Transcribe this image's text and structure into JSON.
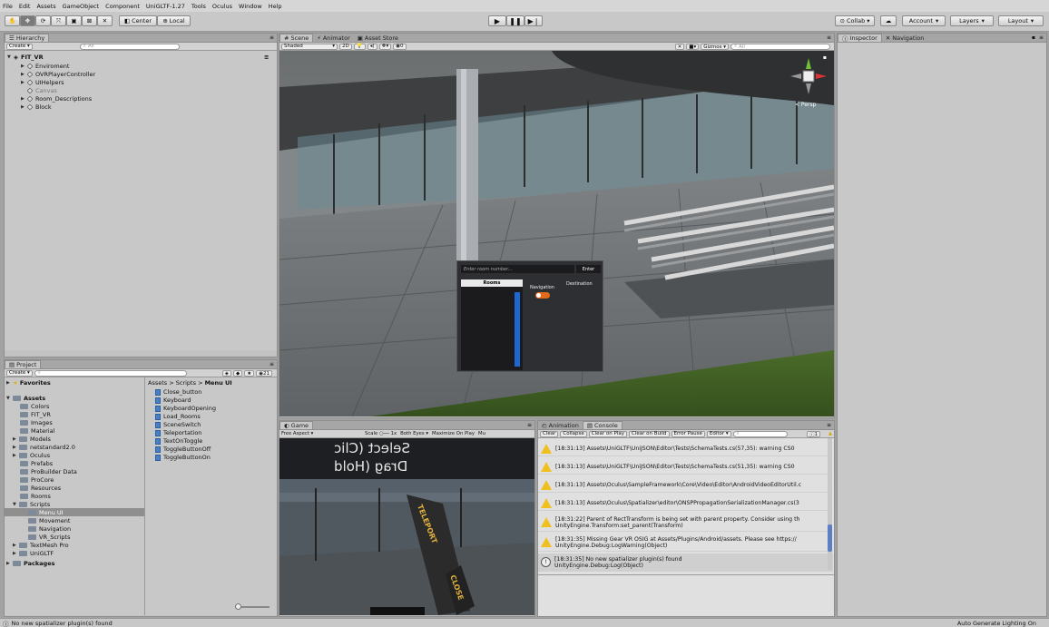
{
  "menu": [
    "File",
    "Edit",
    "Assets",
    "GameObject",
    "Component",
    "UniGLTF-1.27",
    "Tools",
    "Oculus",
    "Window",
    "Help"
  ],
  "toolbar": {
    "center_label": "Center",
    "local_label": "Local",
    "collab_label": "Collab",
    "account_label": "Account",
    "layers_label": "Layers",
    "layout_label": "Layout"
  },
  "hierarchy": {
    "tab": "Hierarchy",
    "create": "Create",
    "search_placeholder": "All",
    "scene_name": "FIT_VR",
    "items": [
      "Enviroment",
      "OVRPlayerController",
      "UIHelpers",
      "Canvas",
      "Room_Descriptions",
      "Block"
    ]
  },
  "scene": {
    "tabs": [
      "Scene",
      "Animator",
      "Asset Store"
    ],
    "shaded": "Shaded",
    "mode_2d": "2D",
    "fx_count": "0",
    "gizmos": "Gizmos",
    "search_placeholder": "All",
    "persp": "< Persp",
    "ui": {
      "input_placeholder": "Enter room number...",
      "enter": "Enter",
      "rooms": "Rooms",
      "navigation": "Navigation",
      "destination": "Destination"
    }
  },
  "inspector": {
    "tabs": [
      "Inspector",
      "Navigation"
    ]
  },
  "project": {
    "tab": "Project",
    "create": "Create",
    "count": "21",
    "favorites": "Favorites",
    "assets": "Assets",
    "folders": [
      "Colors",
      "FIT_VR",
      "Images",
      "Material",
      "Models",
      "netstandard2.0",
      "Oculus",
      "Prefabs",
      "ProBuilder Data",
      "ProCore",
      "Resources",
      "Rooms",
      "Scripts",
      "Menu UI",
      "Movement",
      "Navigation",
      "VR_Scripts",
      "TextMesh Pro",
      "UniGLTF"
    ],
    "packages": "Packages",
    "breadcrumb": [
      "Assets",
      "Scripts",
      "Menu UI"
    ],
    "files": [
      "Close_button",
      "Keyboard",
      "KeyboardOpening",
      "Load_Rooms",
      "SceneSwitch",
      "Teleportation",
      "TextOnToggle",
      "ToggleButtonOff",
      "ToggleButtonOn"
    ]
  },
  "game": {
    "tab": "Game",
    "aspect": "Free Aspect",
    "scale_label": "Scale",
    "scale_value": "1x",
    "both_eyes": "Both Eyes",
    "maximize": "Maximize On Play",
    "mute": "Mu",
    "overlay_text1": "Select (Clic",
    "overlay_text2": "Drag (Hold",
    "sign1": "TELEPORT",
    "sign2": "CLOSE"
  },
  "console": {
    "tabs": [
      "Animation",
      "Console"
    ],
    "buttons": [
      "Clear",
      "Collapse",
      "Clear on Play",
      "Clear on Build",
      "Error Pause",
      "Editor"
    ],
    "info_count": "1",
    "entries": [
      {
        "type": "warning",
        "line1": "[18:31:13] Assets\\UniGLTF\\UniJSON\\Editor\\Tests\\SchemaTests.cs(57,35): warning CS0",
        "line2": ""
      },
      {
        "type": "warning",
        "line1": "[18:31:13] Assets\\UniGLTF\\UniJSON\\Editor\\Tests\\SchemaTests.cs(51,35): warning CS0",
        "line2": ""
      },
      {
        "type": "warning",
        "line1": "[18:31:13] Assets\\Oculus\\SampleFramework\\Core\\Video\\Editor\\AndroidVideoEditorUtil.c",
        "line2": ""
      },
      {
        "type": "warning",
        "line1": "[18:31:13] Assets\\Oculus\\Spatializer\\editor\\ONSPPropagationSerializationManager.cs(3",
        "line2": ""
      },
      {
        "type": "warning",
        "line1": "[18:31:22] Parent of RectTransform is being set with parent property. Consider using th",
        "line2": "UnityEngine.Transform:set_parent(Transform)"
      },
      {
        "type": "warning",
        "line1": "[18:31:35] Missing Gear VR OSIG at Assets/Plugins/Android/assets. Please see https://",
        "line2": "UnityEngine.Debug:LogWarning(Object)"
      },
      {
        "type": "info",
        "line1": "[18:31:35] No new spatializer plugin(s) found",
        "line2": "UnityEngine.Debug:Log(Object)"
      }
    ]
  },
  "status": {
    "message": "No new spatializer plugin(s) found",
    "lighting": "Auto Generate Lighting On"
  }
}
